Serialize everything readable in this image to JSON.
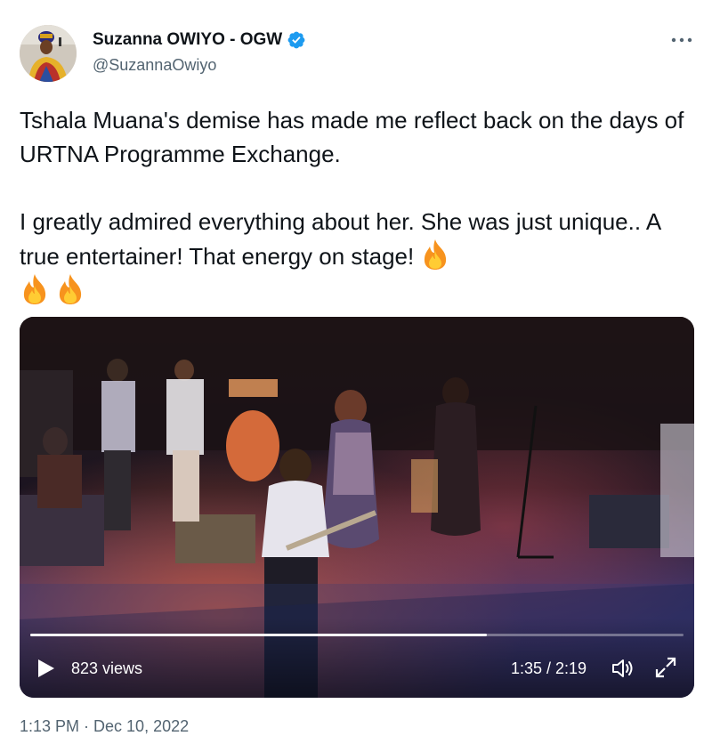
{
  "author": {
    "name": "Suzanna OWIYO - OGW",
    "handle": "@SuzannaOwiyo",
    "verified": true,
    "verified_icon": "verified-badge-icon",
    "avatar_icon": "avatar"
  },
  "more_icon": "more-options-icon",
  "tweet": {
    "text_line1": "Tshala Muana's demise has made me reflect back on the days of URTNA Programme Exchange.",
    "text_line2": "I greatly admired everything about her. She was just unique.. A true entertainer! That energy on stage!",
    "emoji": "fire-icon",
    "emoji_count": 3
  },
  "video": {
    "views": "823 views",
    "time": "1:35 / 2:19",
    "progress": 0.699,
    "play_icon": "play-icon",
    "volume_icon": "volume-icon",
    "fullscreen_icon": "fullscreen-icon"
  },
  "timestamp": "1:13 PM · Dec 10, 2022",
  "colors": {
    "text": "#0f1419",
    "secondary_text": "#536471",
    "verified": "#1d9bf0",
    "video_overlay_text": "#ffffff"
  }
}
